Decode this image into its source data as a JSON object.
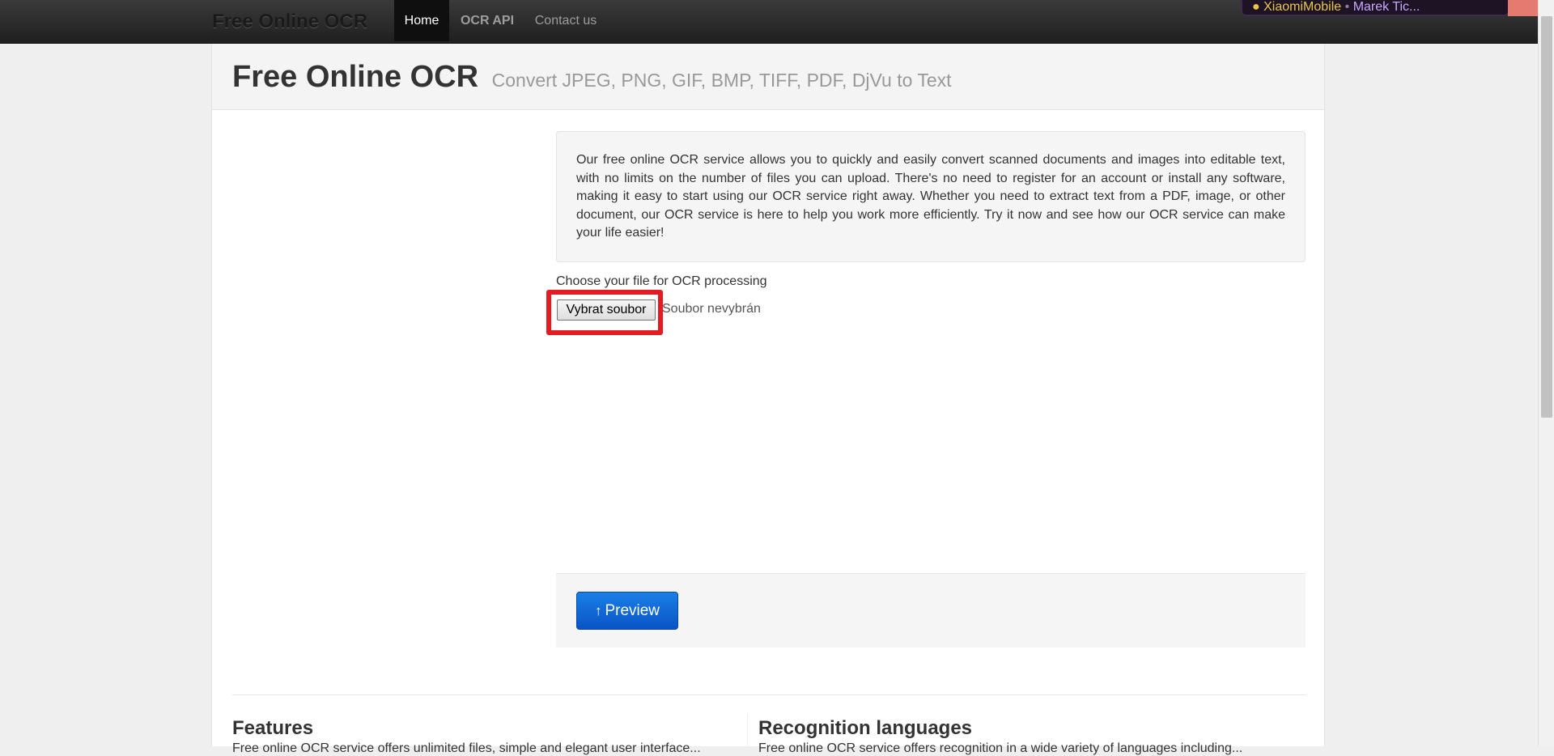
{
  "navbar": {
    "brand": "Free Online OCR",
    "items": [
      {
        "label": "Home",
        "active": true
      },
      {
        "label": "OCR API",
        "active": false
      },
      {
        "label": "Contact us",
        "active": false
      }
    ]
  },
  "overlay": {
    "dot": "●",
    "name": "XiaomiMobile",
    "separator": "•",
    "text": "Marek Tic..."
  },
  "header": {
    "title": "Free Online OCR",
    "subtitle": "Convert JPEG, PNG, GIF, BMP, TIFF, PDF, DjVu to Text"
  },
  "intro": {
    "text": "Our free online OCR service allows you to quickly and easily convert scanned documents and images into editable text, with no limits on the number of files you can upload. There's no need to register for an account or install any software, making it easy to start using our OCR service right away. Whether you need to extract text from a PDF, image, or other document, our OCR service is here to help you work more efficiently. Try it now and see how our OCR service can make your life easier!"
  },
  "upload": {
    "label": "Choose your file for OCR processing",
    "button_label": "Vybrat soubor",
    "status": "Soubor nevybrán"
  },
  "actions": {
    "preview_icon": "↑",
    "preview_label": "Preview"
  },
  "sections": {
    "features_title": "Features",
    "features_text": "Free online OCR service offers unlimited files, simple and elegant user interface...",
    "languages_title": "Recognition languages",
    "languages_text": "Free online OCR service offers recognition in a wide variety of languages including..."
  },
  "colors": {
    "navbar": "#222222",
    "accent_blue": "#0a6ad8",
    "highlight_red": "#e31b23"
  }
}
